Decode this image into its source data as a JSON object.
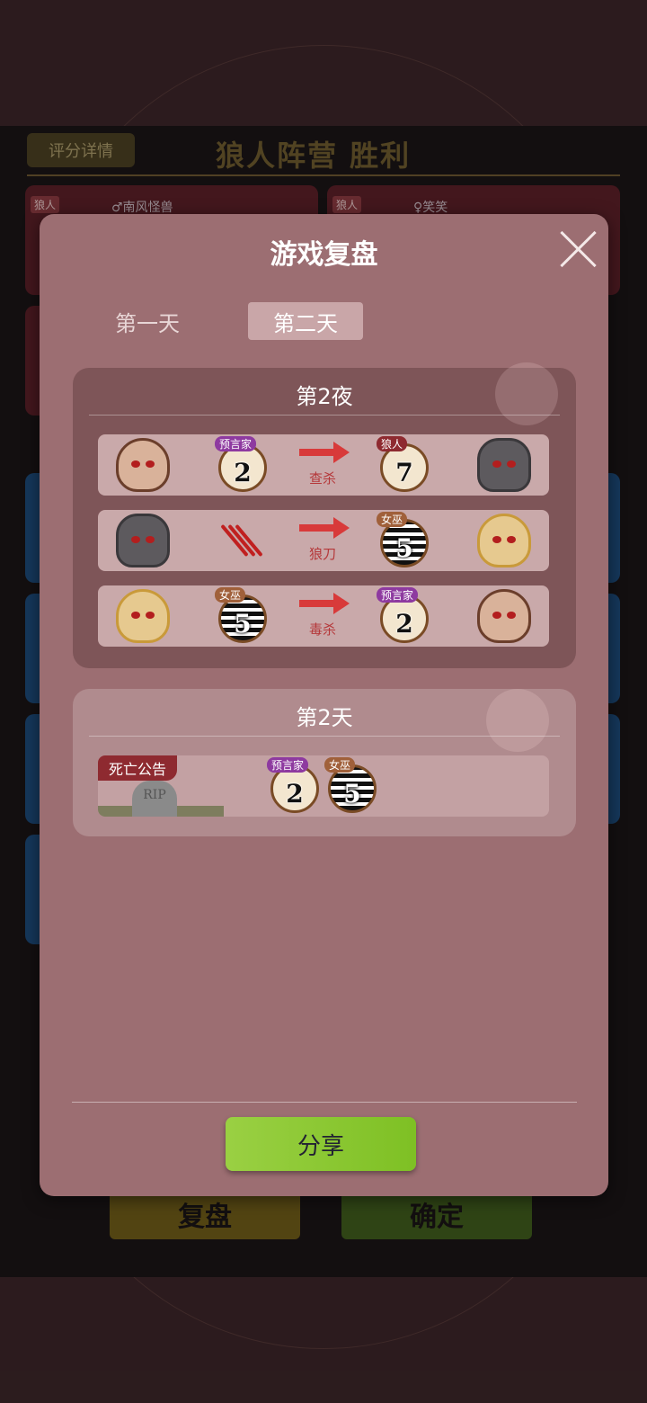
{
  "background": {
    "rating_details": "评分详情",
    "result_title": "狼人阵营  胜利",
    "cards": [
      {
        "role": "狼人",
        "name": "♂南风怪兽"
      },
      {
        "role": "狼人",
        "name": "♀笑笑"
      }
    ],
    "replay_button": "复盘",
    "confirm_button": "确定"
  },
  "modal": {
    "title": "游戏复盘",
    "tabs": [
      {
        "label": "第一天",
        "active": false
      },
      {
        "label": "第二天",
        "active": true
      }
    ],
    "night": {
      "title": "第2夜",
      "events": [
        {
          "actor_role": "预言家",
          "actor_seat": "2",
          "action": "查杀",
          "target_role": "狼人",
          "target_seat": "7"
        },
        {
          "actor_role": "",
          "actor_seat": "",
          "action": "狼刀",
          "target_role": "女巫",
          "target_seat": "5"
        },
        {
          "actor_role": "女巫",
          "actor_seat": "5",
          "action": "毒杀",
          "target_role": "预言家",
          "target_seat": "2"
        }
      ]
    },
    "day": {
      "title": "第2天",
      "death_label": "死亡公告",
      "tombstone_text": "RIP",
      "deaths": [
        {
          "role": "预言家",
          "seat": "2"
        },
        {
          "role": "女巫",
          "seat": "5"
        }
      ]
    },
    "share_button": "分享"
  },
  "colors": {
    "modal_bg": "#9c6e72",
    "night_section": "#7e5558",
    "action_red": "#d83a3a",
    "share_green": "#8cc63a"
  }
}
